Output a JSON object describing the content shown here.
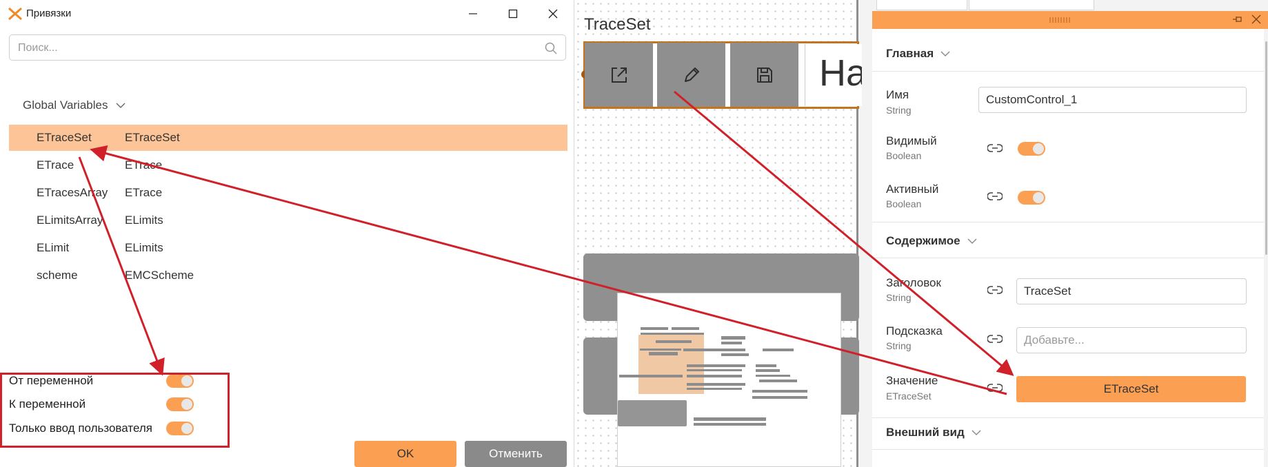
{
  "dialog": {
    "title": "Привязки",
    "search_placeholder": "Поиск...",
    "group_label": "Global Variables",
    "variables": [
      {
        "name": "ETraceSet",
        "type": "ETraceSet",
        "selected": true
      },
      {
        "name": "ETrace",
        "type": "ETrace"
      },
      {
        "name": "ETracesArray",
        "type": "ETrace"
      },
      {
        "name": "ELimitsArray",
        "type": "ELimits"
      },
      {
        "name": "ELimit",
        "type": "ELimits"
      },
      {
        "name": "scheme",
        "type": "EMCScheme"
      }
    ],
    "options": [
      {
        "label": "От переменной",
        "on": true
      },
      {
        "label": "К переменной",
        "on": true
      },
      {
        "label": "Только ввод пользователя",
        "on": true
      }
    ],
    "ok_label": "OK",
    "cancel_label": "Отменить"
  },
  "canvas": {
    "label": "TraceSet",
    "control_text": "Ha"
  },
  "panel": {
    "sections": {
      "main": "Главная",
      "content": "Содержимое",
      "appearance": "Внешний вид"
    },
    "props": {
      "name": {
        "label": "Имя",
        "type": "String",
        "value": "CustomControl_1"
      },
      "visible": {
        "label": "Видимый",
        "type": "Boolean",
        "on": true
      },
      "active": {
        "label": "Активный",
        "type": "Boolean",
        "on": true
      },
      "caption": {
        "label": "Заголовок",
        "type": "String",
        "value": "TraceSet"
      },
      "tooltip": {
        "label": "Подсказка",
        "type": "String",
        "placeholder": "Добавьте..."
      },
      "value": {
        "label": "Значение",
        "type": "ETraceSet",
        "button": "ETraceSet"
      }
    }
  },
  "colors": {
    "accent": "#fb9f53",
    "selection": "#fdc597",
    "annotation": "#d0202a",
    "control_gray": "#8f8f8f"
  }
}
